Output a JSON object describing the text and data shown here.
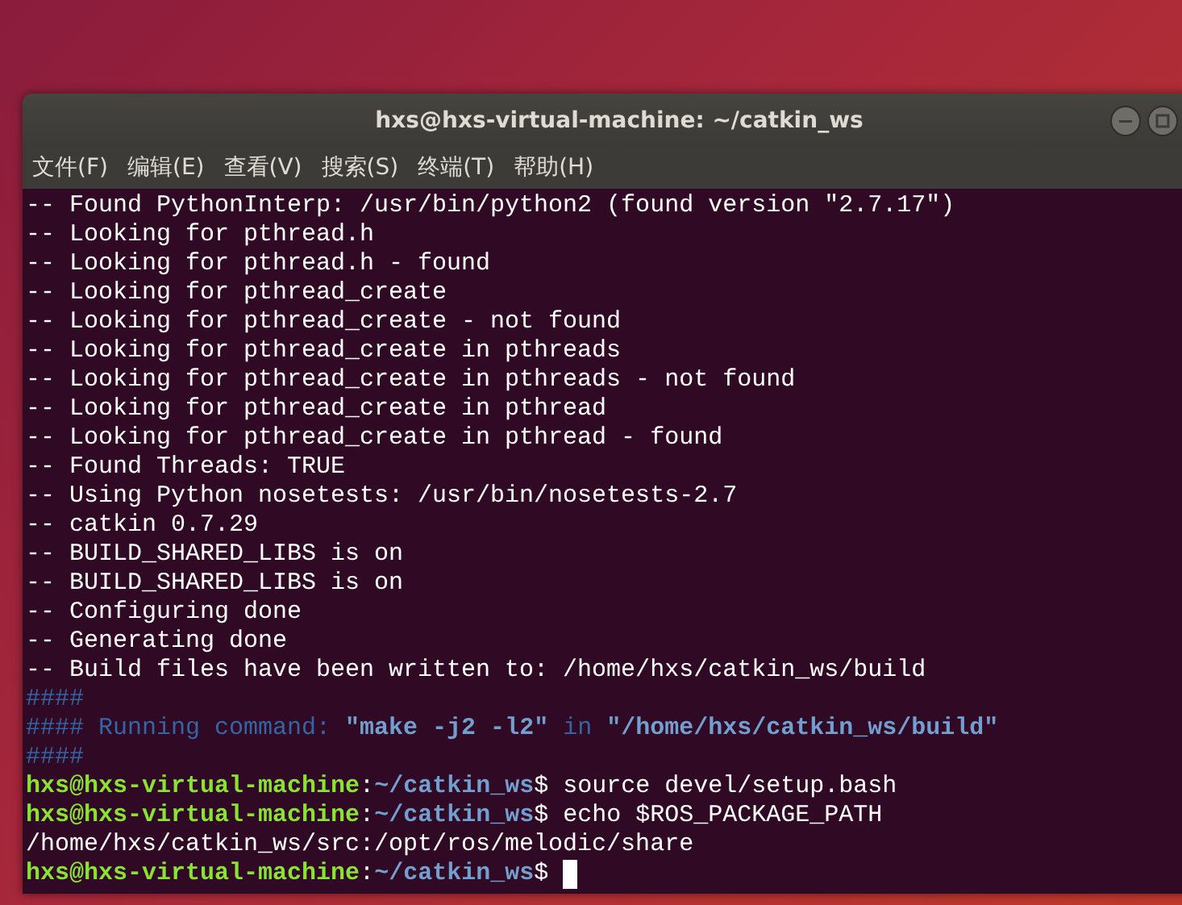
{
  "window": {
    "title": "hxs@hxs-virtual-machine: ~/catkin_ws"
  },
  "menu": [
    "文件(F)",
    "编辑(E)",
    "查看(V)",
    "搜索(S)",
    "终端(T)",
    "帮助(H)"
  ],
  "terminal": {
    "lines": [
      [
        {
          "kind": "plain",
          "text": "-- Found PythonInterp: /usr/bin/python2 (found version \"2.7.17\")"
        }
      ],
      [
        {
          "kind": "plain",
          "text": "-- Looking for pthread.h"
        }
      ],
      [
        {
          "kind": "plain",
          "text": "-- Looking for pthread.h - found"
        }
      ],
      [
        {
          "kind": "plain",
          "text": "-- Looking for pthread_create"
        }
      ],
      [
        {
          "kind": "plain",
          "text": "-- Looking for pthread_create - not found"
        }
      ],
      [
        {
          "kind": "plain",
          "text": "-- Looking for pthread_create in pthreads"
        }
      ],
      [
        {
          "kind": "plain",
          "text": "-- Looking for pthread_create in pthreads - not found"
        }
      ],
      [
        {
          "kind": "plain",
          "text": "-- Looking for pthread_create in pthread"
        }
      ],
      [
        {
          "kind": "plain",
          "text": "-- Looking for pthread_create in pthread - found"
        }
      ],
      [
        {
          "kind": "plain",
          "text": "-- Found Threads: TRUE"
        }
      ],
      [
        {
          "kind": "plain",
          "text": "-- Using Python nosetests: /usr/bin/nosetests-2.7"
        }
      ],
      [
        {
          "kind": "plain",
          "text": "-- catkin 0.7.29"
        }
      ],
      [
        {
          "kind": "plain",
          "text": "-- BUILD_SHARED_LIBS is on"
        }
      ],
      [
        {
          "kind": "plain",
          "text": "-- BUILD_SHARED_LIBS is on"
        }
      ],
      [
        {
          "kind": "plain",
          "text": "-- Configuring done"
        }
      ],
      [
        {
          "kind": "plain",
          "text": "-- Generating done"
        }
      ],
      [
        {
          "kind": "plain",
          "text": "-- Build files have been written to: /home/hxs/catkin_ws/build"
        }
      ],
      [
        {
          "kind": "info",
          "text": "####"
        }
      ],
      [
        {
          "kind": "info",
          "text": "#### Running command: "
        },
        {
          "kind": "info-bold",
          "text": "\"make -j2 -l2\""
        },
        {
          "kind": "info",
          "text": " in "
        },
        {
          "kind": "info-bold",
          "text": "\"/home/hxs/catkin_ws/build\""
        }
      ],
      [
        {
          "kind": "info",
          "text": "####"
        }
      ],
      [
        {
          "kind": "user",
          "text": "hxs@hxs-virtual-machine"
        },
        {
          "kind": "plain",
          "text": ":"
        },
        {
          "kind": "path",
          "text": "~/catkin_ws"
        },
        {
          "kind": "plain",
          "text": "$ source devel/setup.bash"
        }
      ],
      [
        {
          "kind": "user",
          "text": "hxs@hxs-virtual-machine"
        },
        {
          "kind": "plain",
          "text": ":"
        },
        {
          "kind": "path",
          "text": "~/catkin_ws"
        },
        {
          "kind": "plain",
          "text": "$ echo $ROS_PACKAGE_PATH"
        }
      ],
      [
        {
          "kind": "plain",
          "text": "/home/hxs/catkin_ws/src:/opt/ros/melodic/share"
        }
      ],
      [
        {
          "kind": "user",
          "text": "hxs@hxs-virtual-machine"
        },
        {
          "kind": "plain",
          "text": ":"
        },
        {
          "kind": "path",
          "text": "~/catkin_ws"
        },
        {
          "kind": "plain",
          "text": "$ "
        }
      ]
    ],
    "cursor": true
  }
}
